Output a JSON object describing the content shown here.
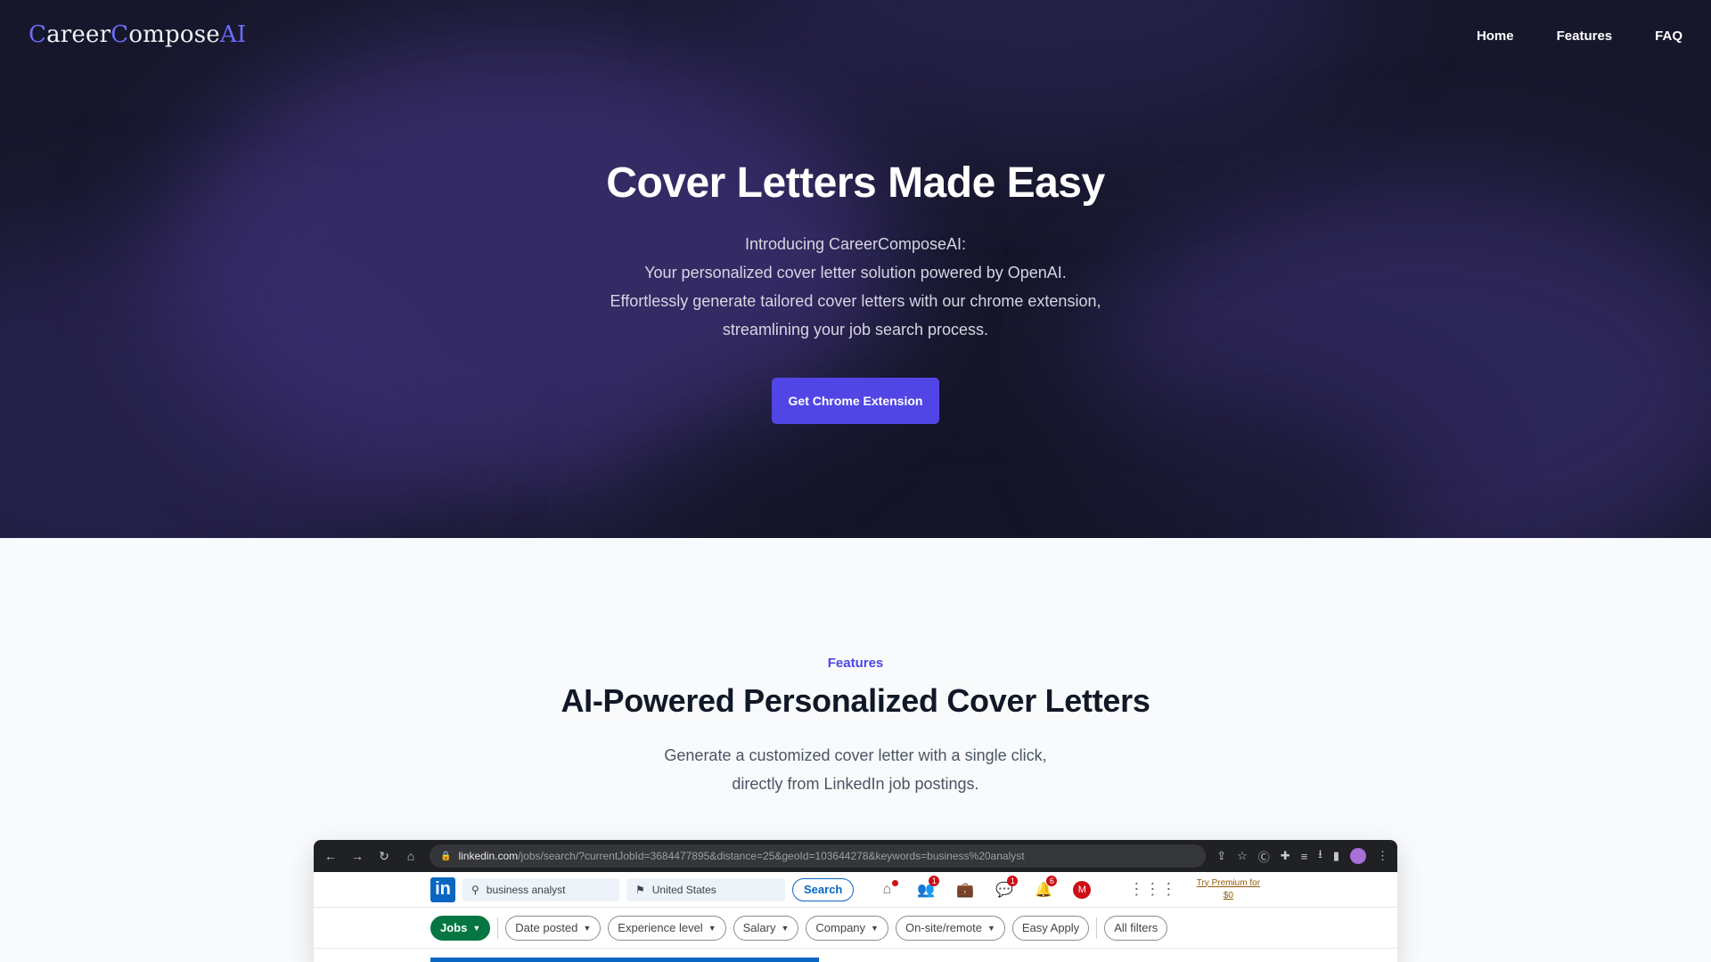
{
  "logo": {
    "c1": "C",
    "p1": "areer",
    "c2": "C",
    "p2": "ompose",
    "ai": "AI"
  },
  "nav": {
    "items": [
      "Home",
      "Features",
      "FAQ"
    ]
  },
  "hero": {
    "title": "Cover Letters Made Easy",
    "lines": [
      "Introducing CareerComposeAI:",
      "Your personalized cover letter solution powered by OpenAI.",
      "Effortlessly generate tailored cover letters with our chrome extension,",
      "streamlining your job search process."
    ],
    "cta": "Get Chrome Extension"
  },
  "features": {
    "eyebrow": "Features",
    "title": "AI-Powered Personalized Cover Letters",
    "lines": [
      "Generate a customized cover letter with a single click,",
      "directly from LinkedIn job postings."
    ]
  },
  "browser": {
    "url_domain": "linkedin.com",
    "url_path": "/jobs/search/?currentJobId=3684477895&distance=25&geoId=103644278&keywords=business%20analyst",
    "linkedin": {
      "logo": "in",
      "search_value": "business analyst",
      "location_value": "United States",
      "search_button": "Search",
      "badges": {
        "home": "",
        "network": "1",
        "messaging": "1",
        "notifications": "6"
      },
      "me_initial": "M",
      "premium_line1": "Try Premium for",
      "premium_line2": "$0"
    },
    "filters": [
      "Jobs",
      "Date posted",
      "Experience level",
      "Salary",
      "Company",
      "On-site/remote",
      "Easy Apply",
      "All filters"
    ]
  },
  "colors": {
    "accent": "#5146e5",
    "hero_bg": "#17172c",
    "linkedin_blue": "#0a66c2",
    "linkedin_green": "#057642"
  }
}
